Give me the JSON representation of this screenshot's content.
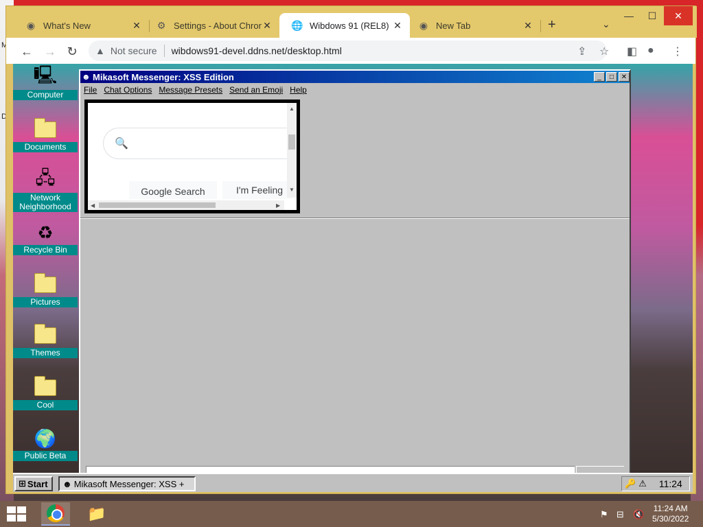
{
  "host": {
    "left_letters": [
      "M",
      "D"
    ]
  },
  "chrome": {
    "tabs": [
      {
        "title": "What's New",
        "icon": "chrome-icon"
      },
      {
        "title": "Settings - About Chrom",
        "icon": "gear-icon"
      },
      {
        "title": "Wibdows 91 (REL8)",
        "icon": "globe-icon"
      },
      {
        "title": "New Tab",
        "icon": "chrome-icon"
      }
    ],
    "active_tab_index": 2,
    "omnibox": {
      "security_label": "Not secure",
      "url": "wibdows91-devel.ddns.net/desktop.html"
    }
  },
  "w91": {
    "desktop_icons": [
      {
        "label": "Computer",
        "icon": "computer-icon"
      },
      {
        "label": "Documents",
        "icon": "folder-icon"
      },
      {
        "label": "Network Neighborhood",
        "icon": "network-icon"
      },
      {
        "label": "Recycle Bin",
        "icon": "recycle-bin-icon"
      },
      {
        "label": "Pictures",
        "icon": "folder-icon"
      },
      {
        "label": "Themes",
        "icon": "folder-icon"
      },
      {
        "label": "Cool",
        "icon": "folder-icon"
      },
      {
        "label": "Public Beta",
        "icon": "globe-shortcut-icon"
      }
    ],
    "messenger": {
      "title": "Mikasoft Messenger: XSS Edition",
      "menu": [
        "File",
        "Chat Options",
        "Message Presets",
        "Send an Emoji",
        "Help"
      ],
      "embedded": {
        "button1": "Google Search",
        "button2": "I'm Feeling"
      }
    },
    "taskbar": {
      "start_label": "Start",
      "task_label": "Mikasoft Messenger: XSS +",
      "clock": "11:24"
    }
  },
  "host_taskbar": {
    "time": "11:24 AM",
    "date": "5/30/2022"
  },
  "colors": {
    "chrome_frame": "#e4c86c",
    "w91_title_start": "#000080",
    "w91_title_end": "#1084d0",
    "w91_face": "#c0c0c0",
    "icon_label_bg": "#008a8a"
  }
}
